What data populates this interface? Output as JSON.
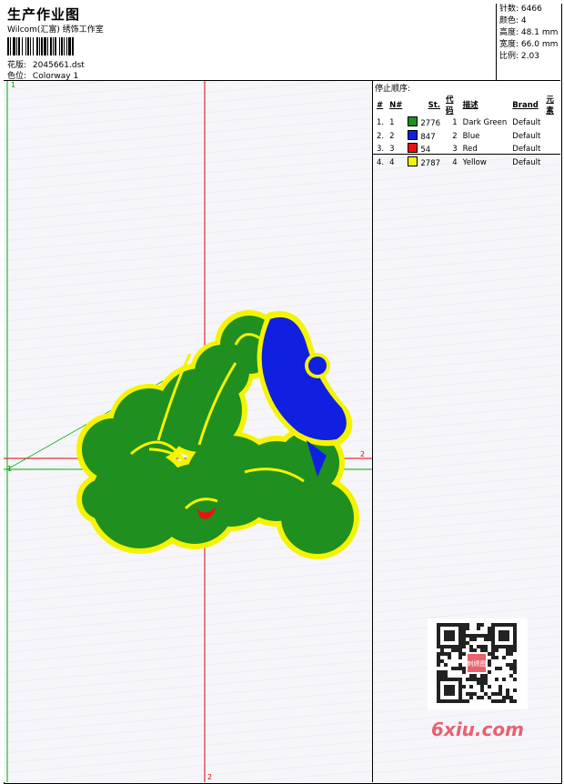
{
  "header": {
    "title": "生产作业图",
    "software": "Wilcom(汇富) 绣饰工作室",
    "design_label": "花版:",
    "design_value": "2045661.dst",
    "colorway_label": "色位:",
    "colorway_value": "Colorway 1"
  },
  "stats": [
    {
      "label": "针数:",
      "value": "6466"
    },
    {
      "label": "颜色:",
      "value": "4"
    },
    {
      "label": "高度:",
      "value": "48.1 mm"
    },
    {
      "label": "宽度:",
      "value": "66.0 mm"
    },
    {
      "label": "比例:",
      "value": "2.03"
    }
  ],
  "stop_sequence": {
    "title": "停止顺序:",
    "headers": [
      "#",
      "N#",
      "St.",
      "代码",
      "描述",
      "Brand",
      "元素"
    ],
    "rows": [
      {
        "idx": "1.",
        "n": "1",
        "st": "2776",
        "code": "1",
        "desc": "Dark Green",
        "brand": "Default",
        "color": "#1f8f1f"
      },
      {
        "idx": "2.",
        "n": "2",
        "st": "847",
        "code": "2",
        "desc": "Blue",
        "brand": "Default",
        "color": "#1020e0"
      },
      {
        "idx": "3.",
        "n": "3",
        "st": "54",
        "code": "3",
        "desc": "Red",
        "brand": "Default",
        "color": "#ee1010"
      },
      {
        "idx": "4.",
        "n": "4",
        "st": "2787",
        "code": "4",
        "desc": "Yellow",
        "brand": "Default",
        "color": "#f4f400"
      }
    ]
  },
  "markers": {
    "start_top": "1",
    "start_left": "1",
    "end_right": "2",
    "end_bottom": "2"
  },
  "watermark": {
    "brand": "6xiu.com",
    "stamp": "刺绣图"
  },
  "colors": {
    "guide_red": "#e00000",
    "guide_green": "#00b000",
    "fill_green": "#1f8f1f",
    "outline_yellow": "#f4f400",
    "fill_blue": "#1020e0"
  }
}
